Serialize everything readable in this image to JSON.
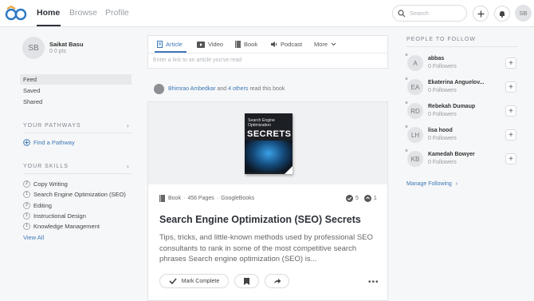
{
  "topbar": {
    "nav": [
      "Home",
      "Browse",
      "Profile"
    ],
    "search_placeholder": "Search",
    "user_initials": "SB"
  },
  "profile": {
    "initials": "SB",
    "name": "Saikat Basu",
    "points": "0 0 pts"
  },
  "left_menu": [
    "Feed",
    "Saved",
    "Shared"
  ],
  "pathways": {
    "title": "YOUR PATHWAYS",
    "find": "Find a Pathway"
  },
  "skills": {
    "title": "YOUR SKILLS",
    "items": [
      {
        "num": "2",
        "label": "Copy Writing"
      },
      {
        "num": "1",
        "label": "Search Engine Optimization (SEO)"
      },
      {
        "num": "2",
        "label": "Editing"
      },
      {
        "num": "1",
        "label": "Instructional Design"
      },
      {
        "num": "1",
        "label": "Knowledge Management"
      }
    ],
    "view_all": "View All"
  },
  "composer": {
    "tabs": [
      "Article",
      "Video",
      "Book",
      "Podcast",
      "More"
    ],
    "placeholder": "Enter a link to an article you've read"
  },
  "activity": {
    "name": "Bhimrao Ambedkar",
    "and": " and ",
    "others": "4 others",
    "suffix": " read this book"
  },
  "card": {
    "book_cover_line1": "Search Engine",
    "book_cover_line2": "Optimization",
    "book_cover_big": "SECRETS",
    "type": "Book",
    "pages": "456 Pages",
    "source": "GoogleBooks",
    "completed_count": "5",
    "recommend_count": "1",
    "title": "Search Engine Optimization (SEO) Secrets",
    "description": "Tips, tricks, and little-known methods used by professional SEO consultants to rank in some of the most competitive search phrases Search engine optimization (SEO) is...",
    "mark_complete": "Mark Complete"
  },
  "people": {
    "title": "PEOPLE TO FOLLOW",
    "items": [
      {
        "initials": "A",
        "name": "abbas",
        "followers": "0 Followers"
      },
      {
        "initials": "EA",
        "name": "Ekaterina Anguelov...",
        "followers": "0 Followers"
      },
      {
        "initials": "RD",
        "name": "Rebekah Dumaup",
        "followers": "0 Followers"
      },
      {
        "initials": "LH",
        "name": "lisa hood",
        "followers": "0 Followers"
      },
      {
        "initials": "KB",
        "name": "Kamedah Bowyer",
        "followers": "0 Followers"
      }
    ],
    "manage": "Manage Following"
  }
}
